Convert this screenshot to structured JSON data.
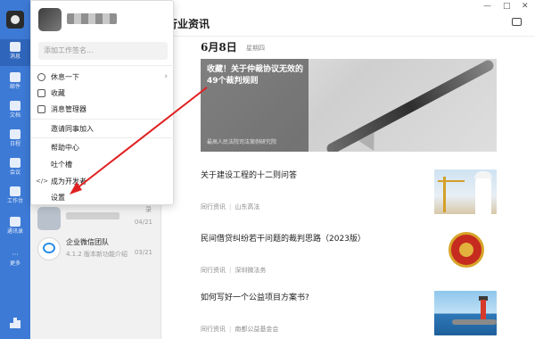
{
  "rail": {
    "items": [
      {
        "label": "消息",
        "active": true
      },
      {
        "label": "邮件"
      },
      {
        "label": "文档"
      },
      {
        "label": "日程"
      },
      {
        "label": "会议"
      },
      {
        "label": "工作台"
      },
      {
        "label": "通讯录"
      },
      {
        "label": "更多"
      }
    ]
  },
  "popup": {
    "signature_placeholder": "添加工作签名...",
    "menu": {
      "rest": "休息一下",
      "favorites": "收藏",
      "message_manager": "消息管理器",
      "invite": "邀请同事加入",
      "help": "帮助中心",
      "feedback": "吐个槽",
      "developer": "成为开发者",
      "settings": "设置"
    }
  },
  "conversations": [
    {
      "tag": "录",
      "time": "04/21"
    },
    {
      "name": "企业微信团队",
      "preview": "4.1.2 版本新功能介绍",
      "time": "03/21"
    }
  ],
  "main": {
    "title": "行业资讯",
    "date": "6月8日",
    "weekday": "星期四",
    "banner": {
      "headline": "收藏！关于仲裁协议无效的49个裁判规则",
      "caption": "最高人民法院司法案例研究院"
    },
    "articles": [
      {
        "title": "关于建设工程的十二则问答",
        "source": "同行资讯",
        "author": "山东高法",
        "thumb": "construction"
      },
      {
        "title": "民间借贷纠纷若干问题的裁判思路（2023版）",
        "source": "同行资讯",
        "author": "深圳微法务",
        "thumb": "emblem"
      },
      {
        "title": "如何写好一个公益项目方案书?",
        "source": "同行资讯",
        "author": "南都公益基金会",
        "thumb": "sea"
      }
    ]
  },
  "colors": {
    "rail_bg": "#3d7ad6",
    "annotation_arrow": "#e02020"
  }
}
